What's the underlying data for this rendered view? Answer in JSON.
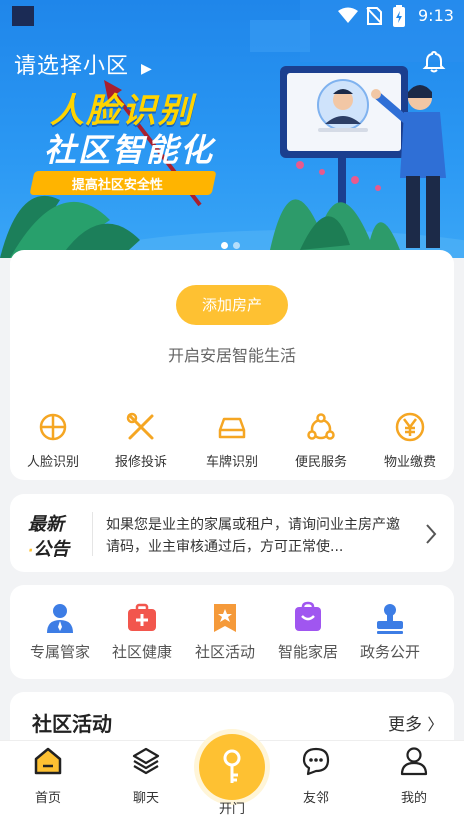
{
  "status": {
    "time": "9:13"
  },
  "header": {
    "community_selector": "请选择小区",
    "bell_icon": "bell-icon"
  },
  "banner": {
    "headline1": "人脸识别",
    "headline2": "社区智能化",
    "tagline": "提高社区安全性",
    "page_count": 2,
    "active_page": 1
  },
  "home": {
    "add_property_button": "添加房产",
    "slogan": "开启安居智能生活",
    "services": [
      {
        "label": "人脸识别",
        "icon": "face-recognition-icon"
      },
      {
        "label": "报修投诉",
        "icon": "repair-tools-icon"
      },
      {
        "label": "车牌识别",
        "icon": "car-icon"
      },
      {
        "label": "便民服务",
        "icon": "service-network-icon"
      },
      {
        "label": "物业缴费",
        "icon": "yen-payment-icon"
      }
    ]
  },
  "announcement": {
    "logo_line1": "最新",
    "logo_line2": "公告",
    "text": "如果您是业主的家属或租户，请询问业主房产邀请码，业主审核通过后，方可正常使..."
  },
  "tools": [
    {
      "label": "专属管家",
      "icon": "butler-icon",
      "color": "#3d7de5"
    },
    {
      "label": "社区健康",
      "icon": "medical-kit-icon",
      "color": "#f2564d"
    },
    {
      "label": "社区活动",
      "icon": "activity-badge-icon",
      "color": "#f59a3a"
    },
    {
      "label": "智能家居",
      "icon": "smart-home-icon",
      "color": "#a056f0"
    },
    {
      "label": "政务公开",
      "icon": "government-stamp-icon",
      "color": "#3d7de5"
    }
  ],
  "activities": {
    "title": "社区活动",
    "more": "更多"
  },
  "tabbar": [
    {
      "label": "首页",
      "icon": "home-icon"
    },
    {
      "label": "聊天",
      "icon": "layers-chat-icon"
    },
    {
      "label": "开门",
      "icon": "key-icon"
    },
    {
      "label": "友邻",
      "icon": "message-bubble-icon"
    },
    {
      "label": "我的",
      "icon": "user-icon"
    }
  ],
  "colors": {
    "brand_blue": "#1f86ea",
    "accent_yellow": "#fec132",
    "text_dark": "#333333"
  }
}
